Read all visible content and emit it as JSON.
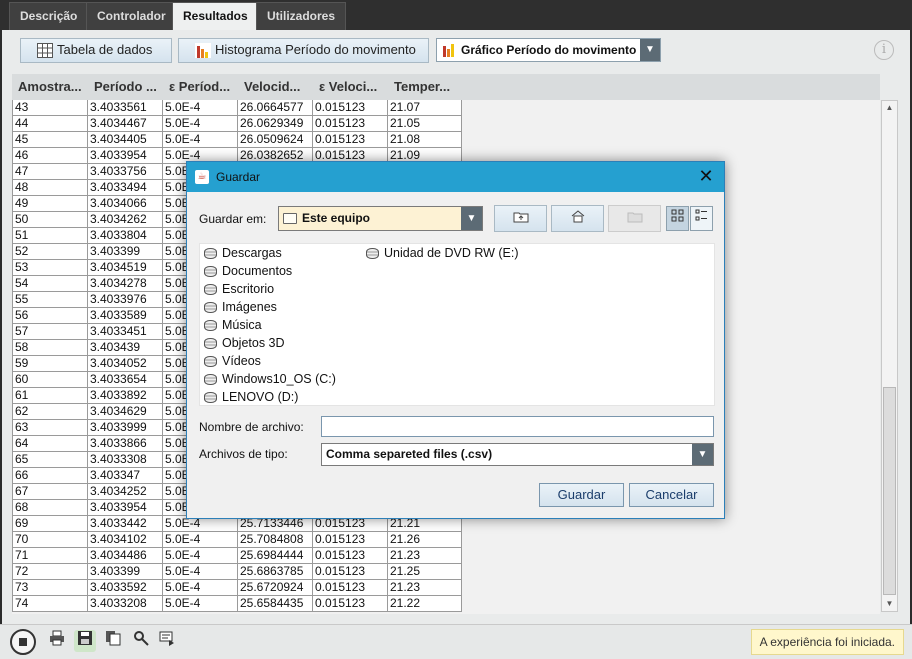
{
  "tabs": [
    {
      "label": "Descrição",
      "active": false
    },
    {
      "label": "Controlador",
      "active": false
    },
    {
      "label": "Resultados",
      "active": true
    },
    {
      "label": "Utilizadores",
      "active": false
    }
  ],
  "toolbar": {
    "data_table_label": "Tabela de dados",
    "histogram_label": "Histograma Período do movimento",
    "chart_select_value": "Gráfico Período do movimento"
  },
  "table": {
    "headers": [
      "Amostra...",
      "Período ...",
      "ε Períod...",
      "Velocid...",
      "ε Veloci...",
      "Temper..."
    ],
    "rows": [
      [
        "43",
        "3.4033561",
        "5.0E-4",
        "26.0664577",
        "0.015123",
        "21.07"
      ],
      [
        "44",
        "3.4034467",
        "5.0E-4",
        "26.0629349",
        "0.015123",
        "21.05"
      ],
      [
        "45",
        "3.4034405",
        "5.0E-4",
        "26.0509624",
        "0.015123",
        "21.08"
      ],
      [
        "46",
        "3.4033954",
        "5.0E-4",
        "26.0382652",
        "0.015123",
        "21.09"
      ],
      [
        "47",
        "3.4033756",
        "5.0E",
        "",
        "",
        ""
      ],
      [
        "48",
        "3.4033494",
        "5.0E",
        "",
        "",
        ""
      ],
      [
        "49",
        "3.4034066",
        "5.0E",
        "",
        "",
        ""
      ],
      [
        "50",
        "3.4034262",
        "5.0E",
        "",
        "",
        ""
      ],
      [
        "51",
        "3.4033804",
        "5.0E",
        "",
        "",
        ""
      ],
      [
        "52",
        "3.403399",
        "5.0E",
        "",
        "",
        ""
      ],
      [
        "53",
        "3.4034519",
        "5.0E",
        "",
        "",
        ""
      ],
      [
        "54",
        "3.4034278",
        "5.0E",
        "",
        "",
        ""
      ],
      [
        "55",
        "3.4033976",
        "5.0E",
        "",
        "",
        ""
      ],
      [
        "56",
        "3.4033589",
        "5.0E",
        "",
        "",
        ""
      ],
      [
        "57",
        "3.4033451",
        "5.0E",
        "",
        "",
        ""
      ],
      [
        "58",
        "3.403439",
        "5.0E",
        "",
        "",
        ""
      ],
      [
        "59",
        "3.4034052",
        "5.0E",
        "",
        "",
        ""
      ],
      [
        "60",
        "3.4033654",
        "5.0E",
        "",
        "",
        ""
      ],
      [
        "61",
        "3.4033892",
        "5.0E",
        "",
        "",
        ""
      ],
      [
        "62",
        "3.4034629",
        "5.0E",
        "",
        "",
        ""
      ],
      [
        "63",
        "3.4033999",
        "5.0E",
        "",
        "",
        ""
      ],
      [
        "64",
        "3.4033866",
        "5.0E",
        "",
        "",
        ""
      ],
      [
        "65",
        "3.4033308",
        "5.0E",
        "",
        "",
        ""
      ],
      [
        "66",
        "3.403347",
        "5.0E",
        "",
        "",
        ""
      ],
      [
        "67",
        "3.4034252",
        "5.0E",
        "",
        "",
        ""
      ],
      [
        "68",
        "3.4033954",
        "5.0E",
        "",
        "",
        ""
      ],
      [
        "69",
        "3.4033442",
        "5.0E-4",
        "25.7133446",
        "0.015123",
        "21.21"
      ],
      [
        "70",
        "3.4034102",
        "5.0E-4",
        "25.7084808",
        "0.015123",
        "21.26"
      ],
      [
        "71",
        "3.4034486",
        "5.0E-4",
        "25.6984444",
        "0.015123",
        "21.23"
      ],
      [
        "72",
        "3.403399",
        "5.0E-4",
        "25.6863785",
        "0.015123",
        "21.25"
      ],
      [
        "73",
        "3.4033592",
        "5.0E-4",
        "25.6720924",
        "0.015123",
        "21.23"
      ],
      [
        "74",
        "3.4033208",
        "5.0E-4",
        "25.6584435",
        "0.015123",
        "21.22"
      ]
    ]
  },
  "status": {
    "message": "A experiência foi iniciada."
  },
  "dialog": {
    "title": "Guardar",
    "look_in_label": "Guardar em:",
    "look_in_value": "Este equipo",
    "files": [
      {
        "name": "Descargas",
        "icon": "drive-icon"
      },
      {
        "name": "Documentos",
        "icon": "drive-icon"
      },
      {
        "name": "Escritorio",
        "icon": "drive-icon"
      },
      {
        "name": "Imágenes",
        "icon": "drive-icon"
      },
      {
        "name": "Música",
        "icon": "drive-icon"
      },
      {
        "name": "Objetos 3D",
        "icon": "drive-icon"
      },
      {
        "name": "Vídeos",
        "icon": "drive-icon"
      },
      {
        "name": "Windows10_OS (C:)",
        "icon": "drive-icon"
      },
      {
        "name": "LENOVO (D:)",
        "icon": "drive-icon"
      },
      {
        "name": "Unidad de DVD RW (E:)",
        "icon": "drive-icon"
      }
    ],
    "filename_label": "Nombre de archivo:",
    "filename_value": "",
    "filetype_label": "Archivos de tipo:",
    "filetype_value": "Comma separeted files (.csv)",
    "save_label": "Guardar",
    "cancel_label": "Cancelar"
  }
}
